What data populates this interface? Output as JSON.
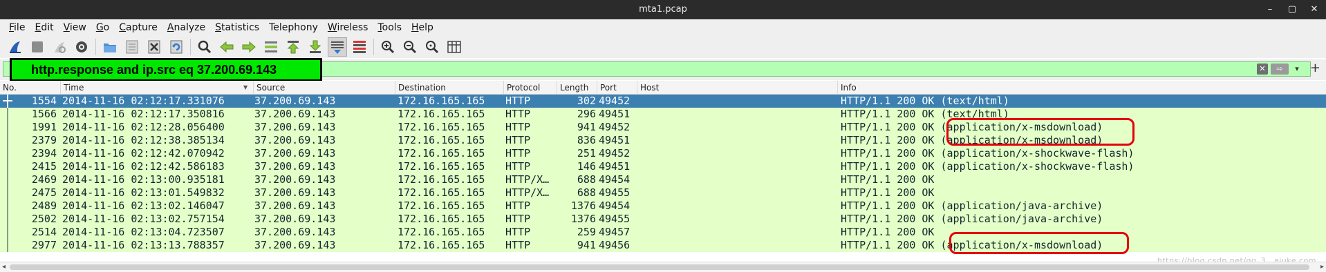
{
  "window": {
    "title": "mta1.pcap",
    "controls": [
      "–",
      "▢",
      "✕"
    ]
  },
  "menubar": {
    "items": [
      {
        "label": "File",
        "underline": "F",
        "rest": "ile"
      },
      {
        "label": "Edit",
        "underline": "E",
        "rest": "dit"
      },
      {
        "label": "View",
        "underline": "V",
        "rest": "iew"
      },
      {
        "label": "Go",
        "underline": "G",
        "rest": "o"
      },
      {
        "label": "Capture",
        "underline": "C",
        "rest": "apture"
      },
      {
        "label": "Analyze",
        "underline": "A",
        "rest": "nalyze"
      },
      {
        "label": "Statistics",
        "underline": "S",
        "rest": "tatistics"
      },
      {
        "label": "Telephony",
        "underline": "",
        "rest": "Telephony"
      },
      {
        "label": "Wireless",
        "underline": "W",
        "rest": "ireless"
      },
      {
        "label": "Tools",
        "underline": "T",
        "rest": "ools"
      },
      {
        "label": "Help",
        "underline": "H",
        "rest": "elp"
      }
    ]
  },
  "toolbar": {
    "icons": [
      "shark-fin-start-icon",
      "stop-capture-icon",
      "restart-capture-icon",
      "capture-options-icon",
      "open-file-icon",
      "save-file-icon",
      "close-file-icon",
      "reload-file-icon",
      "find-packet-icon",
      "go-back-icon",
      "go-forward-icon",
      "go-to-packet-icon",
      "first-packet-icon",
      "last-packet-icon",
      "autoscroll-icon",
      "colorize-icon",
      "zoom-in-icon",
      "zoom-out-icon",
      "normal-size-icon",
      "resize-columns-icon"
    ]
  },
  "filter": {
    "expression": "http.response and ip.src eq 37.200.69.143",
    "clear_glyph": "✕",
    "apply_glyph": "⇨",
    "dropdown_glyph": "▾",
    "add_glyph": "+"
  },
  "columns": {
    "no": "No.",
    "time": "Time",
    "source": "Source",
    "destination": "Destination",
    "protocol": "Protocol",
    "length": "Length",
    "port": "Port",
    "host": "Host",
    "info": "Info"
  },
  "packets": [
    {
      "no": "1554",
      "time": "2014-11-16 02:12:17.331076",
      "source": "37.200.69.143",
      "destination": "172.16.165.165",
      "protocol": "HTTP",
      "length": "302",
      "port": "49452",
      "host": "",
      "info": "HTTP/1.1 200 OK  (text/html)"
    },
    {
      "no": "1566",
      "time": "2014-11-16 02:12:17.350816",
      "source": "37.200.69.143",
      "destination": "172.16.165.165",
      "protocol": "HTTP",
      "length": "296",
      "port": "49451",
      "host": "",
      "info": "HTTP/1.1 200 OK  (text/html)"
    },
    {
      "no": "1991",
      "time": "2014-11-16 02:12:28.056400",
      "source": "37.200.69.143",
      "destination": "172.16.165.165",
      "protocol": "HTTP",
      "length": "941",
      "port": "49452",
      "host": "",
      "info": "HTTP/1.1 200 OK  (application/x-msdownload)"
    },
    {
      "no": "2379",
      "time": "2014-11-16 02:12:38.385134",
      "source": "37.200.69.143",
      "destination": "172.16.165.165",
      "protocol": "HTTP",
      "length": "836",
      "port": "49451",
      "host": "",
      "info": "HTTP/1.1 200 OK  (application/x-msdownload)"
    },
    {
      "no": "2394",
      "time": "2014-11-16 02:12:42.070942",
      "source": "37.200.69.143",
      "destination": "172.16.165.165",
      "protocol": "HTTP",
      "length": "251",
      "port": "49452",
      "host": "",
      "info": "HTTP/1.1 200 OK  (application/x-shockwave-flash)"
    },
    {
      "no": "2415",
      "time": "2014-11-16 02:12:42.586183",
      "source": "37.200.69.143",
      "destination": "172.16.165.165",
      "protocol": "HTTP",
      "length": "146",
      "port": "49451",
      "host": "",
      "info": "HTTP/1.1 200 OK  (application/x-shockwave-flash)"
    },
    {
      "no": "2469",
      "time": "2014-11-16 02:13:00.935181",
      "source": "37.200.69.143",
      "destination": "172.16.165.165",
      "protocol": "HTTP/X…",
      "length": "688",
      "port": "49454",
      "host": "",
      "info": "HTTP/1.1 200 OK"
    },
    {
      "no": "2475",
      "time": "2014-11-16 02:13:01.549832",
      "source": "37.200.69.143",
      "destination": "172.16.165.165",
      "protocol": "HTTP/X…",
      "length": "688",
      "port": "49455",
      "host": "",
      "info": "HTTP/1.1 200 OK"
    },
    {
      "no": "2489",
      "time": "2014-11-16 02:13:02.146047",
      "source": "37.200.69.143",
      "destination": "172.16.165.165",
      "protocol": "HTTP",
      "length": "1376",
      "port": "49454",
      "host": "",
      "info": "HTTP/1.1 200 OK  (application/java-archive)"
    },
    {
      "no": "2502",
      "time": "2014-11-16 02:13:02.757154",
      "source": "37.200.69.143",
      "destination": "172.16.165.165",
      "protocol": "HTTP",
      "length": "1376",
      "port": "49455",
      "host": "",
      "info": "HTTP/1.1 200 OK  (application/java-archive)"
    },
    {
      "no": "2514",
      "time": "2014-11-16 02:13:04.723507",
      "source": "37.200.69.143",
      "destination": "172.16.165.165",
      "protocol": "HTTP",
      "length": "259",
      "port": "49457",
      "host": "",
      "info": "HTTP/1.1 200 OK"
    },
    {
      "no": "2977",
      "time": "2014-11-16 02:13:13.788357",
      "source": "37.200.69.143",
      "destination": "172.16.165.165",
      "protocol": "HTTP",
      "length": "941",
      "port": "49456",
      "host": "",
      "info": "HTTP/1.1 200 OK  (application/x-msdownload)"
    }
  ],
  "selected_row": 0,
  "colors": {
    "row_bg": "#e4ffc7",
    "selected_bg": "#3c7fb1",
    "filter_bg": "#b5ffb5",
    "callout_bg": "#00e800",
    "annotation": "#e3000b"
  },
  "watermark": "https://blog.csdn.net/qq_3...ajuke.com"
}
